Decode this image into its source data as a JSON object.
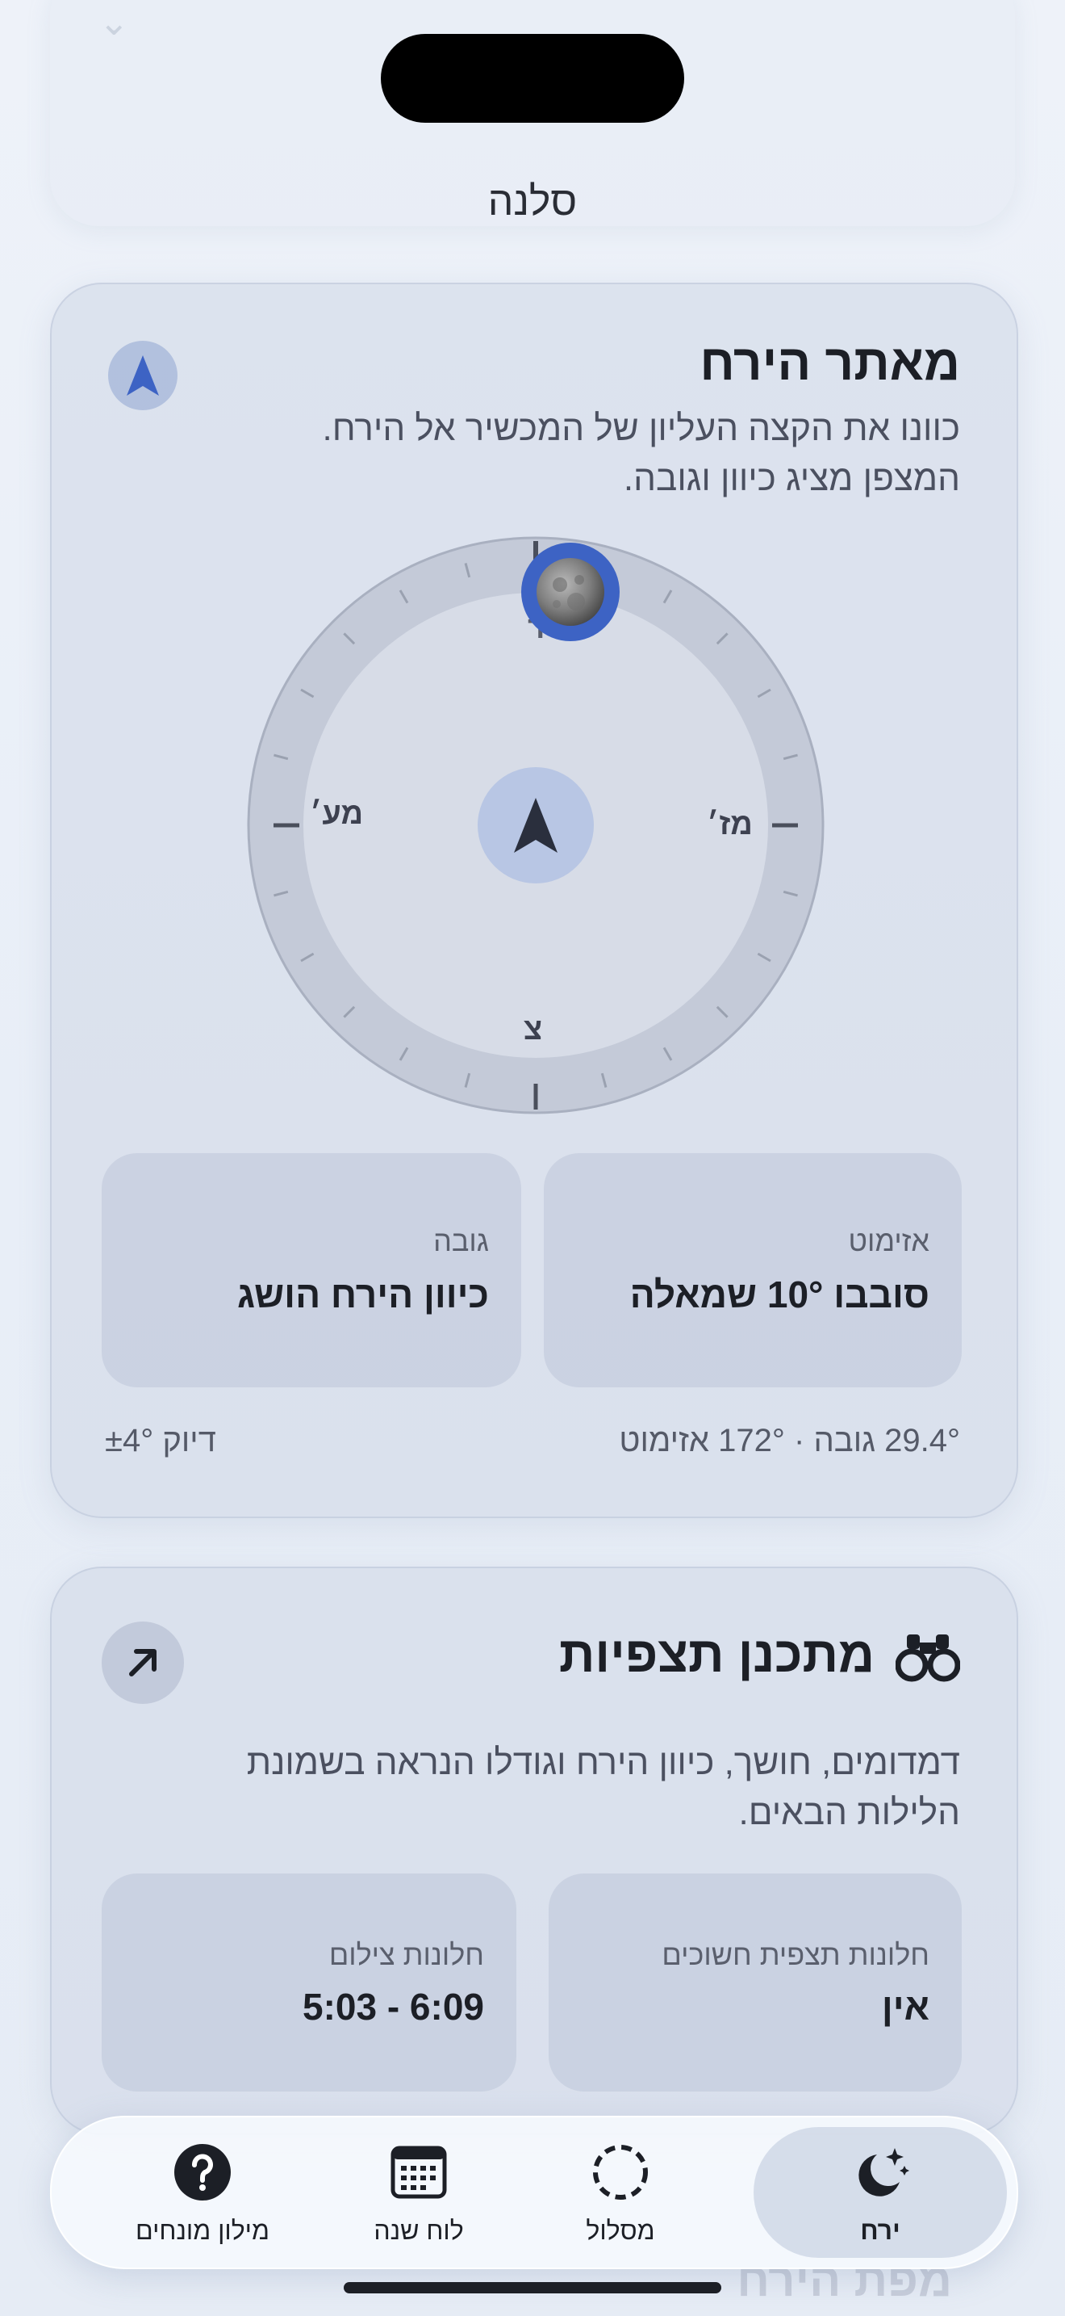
{
  "app": {
    "title": "סלנה"
  },
  "finder": {
    "title": "מאתר הירח",
    "description_line1": "כוונו את הקצה העליון של המכשיר אל הירח.",
    "description_line2": "המצפן מציג כיוון וגובה.",
    "compass": {
      "north_label": "צ",
      "east_label": "מז׳",
      "west_label": "מע׳",
      "south_label": "ד",
      "moon_azimuth_offset_deg": 10
    },
    "azimuth": {
      "label": "אזימוט",
      "value": "סובבו 10° שמאלה"
    },
    "altitude": {
      "label": "גובה",
      "value": "כיוון הירח הושג"
    },
    "footer_reading": "29.4° גובה · 172° אזימוט",
    "footer_accuracy": "דיוק ±4°"
  },
  "planner": {
    "title": "מתכנן תצפיות",
    "description_line1": "דמדומים, חושך, כיוון הירח וגודלו הנראה בשמונת",
    "description_line2": "הלילות הבאים.",
    "dark_window": {
      "label": "חלונות תצפית חשוכים",
      "value": "אין"
    },
    "photo_window": {
      "label": "חלונות צילום",
      "value": "5:03 - 6:09"
    }
  },
  "tabs": [
    {
      "label": "ירח",
      "icon": "moon-stars-icon",
      "active": true
    },
    {
      "label": "מסלול",
      "icon": "orbit-dashed-circle-icon",
      "active": false
    },
    {
      "label": "לוח שנה",
      "icon": "calendar-icon",
      "active": false
    },
    {
      "label": "מילון מונחים",
      "icon": "question-circle-icon",
      "active": false
    }
  ],
  "colors": {
    "accent": "#3d63c4",
    "text": "#1c1f26"
  }
}
